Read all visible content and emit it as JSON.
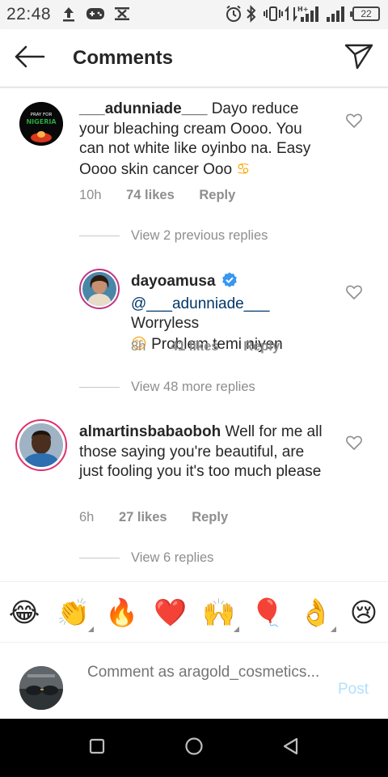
{
  "status_bar": {
    "time": "22:48",
    "battery": "22"
  },
  "header": {
    "title": "Comments",
    "back_icon": "arrow-left-icon",
    "send_icon": "paper-plane-icon"
  },
  "comments": [
    {
      "username": "___adunniade___",
      "text": "Dayo reduce your bleaching cream Oooo. You can not white like oyinbo na. Easy Oooo skin cancer Ooo",
      "emoji": "♋",
      "time": "10h",
      "likes": "74 likes",
      "reply": "Reply",
      "avatar_text": [
        "PRAY FOR",
        "NIGERIA"
      ]
    },
    {
      "username": "dayoamusa",
      "verified": true,
      "mention": "@___adunniade___",
      "text": "Worryless",
      "emoji": "😊",
      "text2": "Problem temi niyen",
      "time": "8h",
      "likes": "41 likes",
      "reply": "Reply"
    },
    {
      "username": "almartinsbabaoboh",
      "text": "Well for me all those saying you're beautiful, are just fooling you it's too much please",
      "time": "6h",
      "likes": "27 likes",
      "reply": "Reply"
    }
  ],
  "view_replies": [
    "View 2 previous replies",
    "View 48 more replies",
    "View 6 replies"
  ],
  "emoji_bar": [
    "😂",
    "👏",
    "🔥",
    "❤️",
    "🙌",
    "🎈",
    "👌",
    "😢"
  ],
  "comment_input": {
    "placeholder": "Comment as aragold_cosmetics...",
    "post_label": "Post"
  },
  "colors": {
    "link": "#00376b",
    "meta": "#8e8e8e",
    "post_disabled": "#b2dffc",
    "verified": "#3897f0"
  }
}
